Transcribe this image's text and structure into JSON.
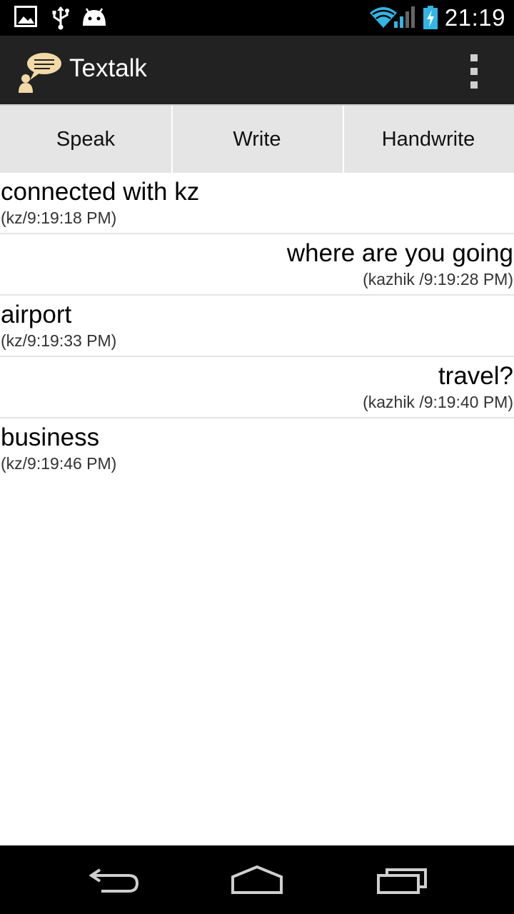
{
  "status_bar": {
    "time": "21:19",
    "icons": [
      "image-icon",
      "usb-icon",
      "android-icon",
      "wifi-icon",
      "signal-icon",
      "battery-charging-icon"
    ]
  },
  "action_bar": {
    "title": "Textalk",
    "logo_icon": "speech-bubble-person-icon",
    "overflow_icon": "overflow-menu-icon"
  },
  "tabs": [
    {
      "label": "Speak"
    },
    {
      "label": "Write"
    },
    {
      "label": "Handwrite"
    }
  ],
  "messages": [
    {
      "text": "connected with kz",
      "meta": "(kz/9:19:18 PM)",
      "align": "left"
    },
    {
      "text": "where are you going",
      "meta": "(kazhik /9:19:28 PM)",
      "align": "right"
    },
    {
      "text": "airport",
      "meta": "(kz/9:19:33 PM)",
      "align": "left"
    },
    {
      "text": "travel?",
      "meta": "(kazhik /9:19:40 PM)",
      "align": "right"
    },
    {
      "text": "business",
      "meta": "(kz/9:19:46 PM)",
      "align": "left"
    }
  ],
  "nav_bar": {
    "icons": [
      "back-icon",
      "home-icon",
      "recents-icon"
    ]
  },
  "colors": {
    "status_bar_bg": "#000000",
    "action_bar_bg": "#222222",
    "tab_bg": "#e5e5e5",
    "wifi_accent": "#33b5e5",
    "logo_accent": "#f2d9a6"
  }
}
